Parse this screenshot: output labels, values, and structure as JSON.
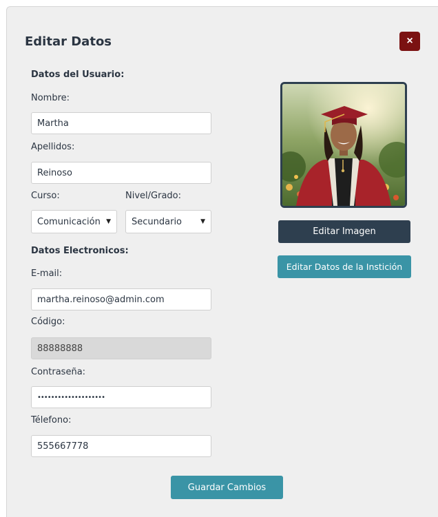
{
  "modal": {
    "title": "Editar Datos",
    "close_label": "×"
  },
  "user_section": {
    "heading": "Datos del Usuario:",
    "nombre_label": "Nombre:",
    "nombre_value": "Martha",
    "apellidos_label": "Apellidos:",
    "apellidos_value": "Reinoso",
    "curso_label": "Curso:",
    "curso_value": "Comunicación",
    "nivel_label": "Nivel/Grado:",
    "nivel_value": "Secundario"
  },
  "electronic_section": {
    "heading": "Datos Electronicos:",
    "email_label": "E-mail:",
    "email_value": "martha.reinoso@admin.com",
    "codigo_label": "Código:",
    "codigo_value": "88888888",
    "password_label": "Contraseña:",
    "password_value": "••••••••••••••••••••",
    "telefono_label": "Télefono:",
    "telefono_value": "555667778"
  },
  "actions": {
    "edit_image": "Editar Imagen",
    "edit_institution": "Editar Datos de la Instición",
    "save": "Guardar Cambios"
  },
  "colors": {
    "dark_button": "#2e3f4f",
    "teal_button": "#3a94a6",
    "close_button": "#7b1212"
  }
}
